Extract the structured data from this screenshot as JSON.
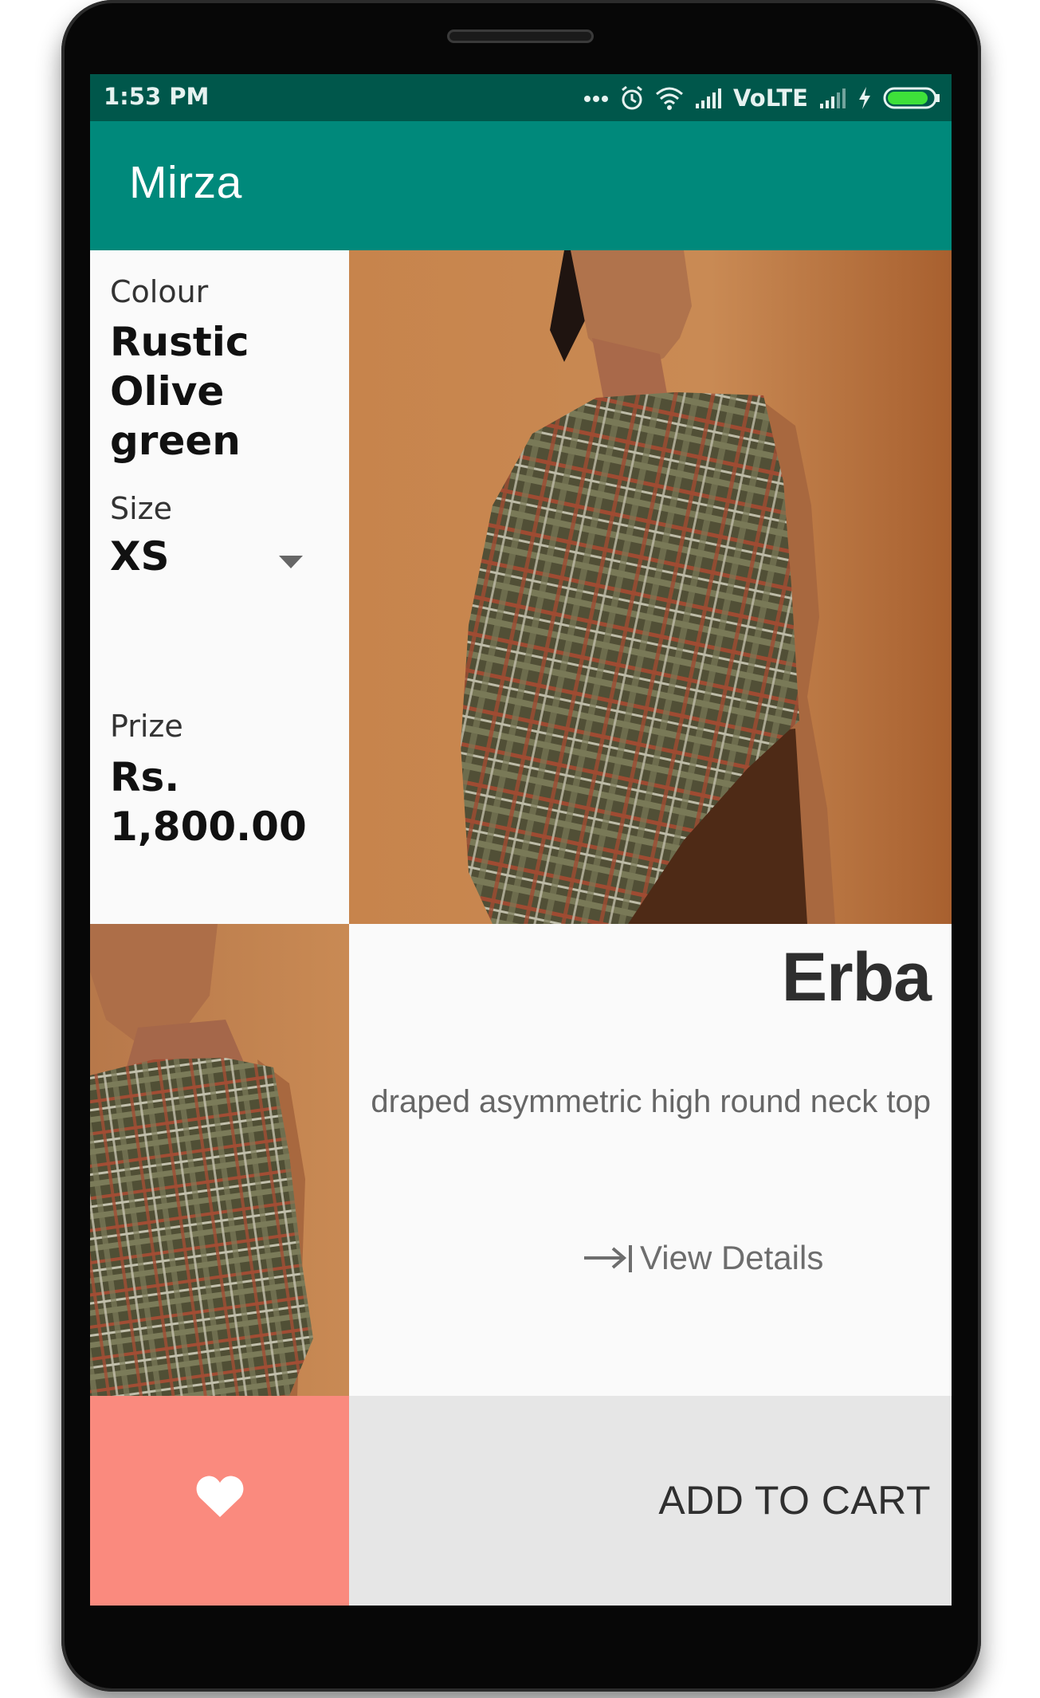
{
  "status_bar": {
    "time": "1:53 PM",
    "network_label": "VoLTE",
    "icons": [
      "more-dots-icon",
      "alarm-icon",
      "wifi-icon",
      "signal-icon",
      "signal-icon",
      "charging-icon",
      "battery-icon"
    ],
    "battery_level": 0.9
  },
  "app_bar": {
    "title": "Mirza"
  },
  "product_info": {
    "colour_label": "Colour",
    "colour_value": "Rustic Olive green",
    "size_label": "Size",
    "size_value": "XS",
    "price_label": "Prize",
    "price_value": "Rs. 1,800.00"
  },
  "product": {
    "name": "Erba",
    "description": "draped asymmetric high round neck top",
    "view_details_label": "View Details"
  },
  "actions": {
    "favorite_icon": "heart-icon",
    "add_to_cart_label": "ADD TO CART"
  },
  "colors": {
    "status_bar": "#00574b",
    "app_bar": "#00897b",
    "favorite_button": "#fa8a7e",
    "cart_button": "#e6e6e6",
    "photo_background": "#c9874f"
  }
}
